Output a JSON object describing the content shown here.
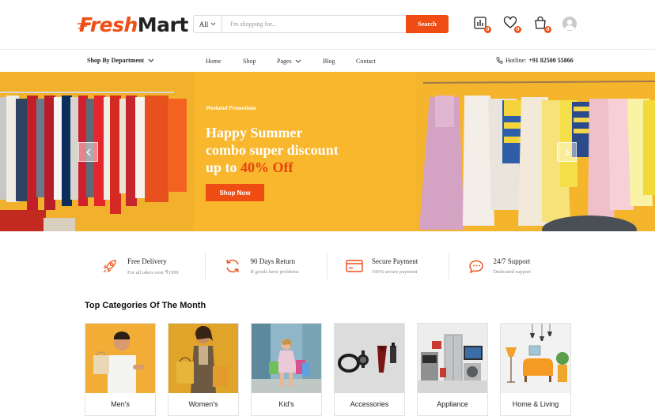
{
  "brand": {
    "part1": "Fresh",
    "part2": "Mart"
  },
  "search": {
    "category": "All",
    "placeholder": "I'm shopping for...",
    "button": "Search"
  },
  "header_icons": [
    {
      "name": "compare-icon",
      "badge": "0"
    },
    {
      "name": "heart-icon",
      "badge": "0"
    },
    {
      "name": "cart-icon",
      "badge": "0"
    }
  ],
  "nav": {
    "department": "Shop By Department",
    "links": [
      "Home",
      "Shop",
      "Pages",
      "Blog",
      "Contact"
    ],
    "hotline_label": "Hotline:",
    "hotline_number": "+91 82500 55866"
  },
  "hero": {
    "tag": "Weekend Promotions",
    "line1": "Happy Summer",
    "line2": "combo super discount",
    "line3_prefix": "up to",
    "line3_highlight": "40% Off",
    "button": "Shop Now",
    "accent": "#f8b72c"
  },
  "features": [
    {
      "title": "Free Delivery",
      "sub": "For all oders over ₹1999",
      "icon": "rocket-icon"
    },
    {
      "title": "90 Days Return",
      "sub": "If goods have problems",
      "icon": "refresh-icon"
    },
    {
      "title": "Secure Payment",
      "sub": "100% secure payment",
      "icon": "credit-card-icon"
    },
    {
      "title": "24/7 Support",
      "sub": "Dedicated support",
      "icon": "chat-icon"
    }
  ],
  "categories": {
    "heading": "Top Categories Of The Month",
    "items": [
      "Men's",
      "Women's",
      "Kid's",
      "Accessories",
      "Appliance",
      "Home & Living"
    ]
  },
  "colors": {
    "brand": "#f04d15",
    "hero": "#f8b72c"
  }
}
